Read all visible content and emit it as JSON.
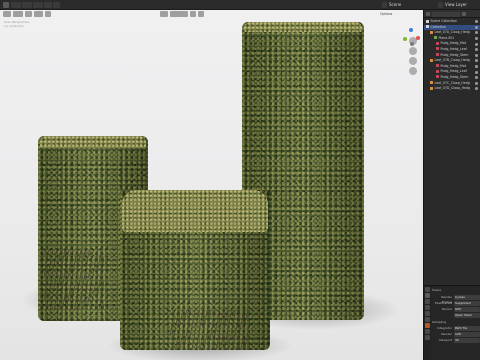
{
  "topbar": {
    "scene_label": "Scene",
    "view_layer_label": "View Layer"
  },
  "viewport": {
    "view_name": "User Perspective",
    "collection_label": "(1) Collection",
    "shading_label": "Options"
  },
  "outliner": {
    "title": "Scene Collection",
    "items": [
      {
        "label": "Scene Collection",
        "type": "collection",
        "selected": false
      },
      {
        "label": "Collection",
        "type": "collection",
        "selected": true
      },
      {
        "label": "Leaf_07A_Cloop_Hedg",
        "type": "object",
        "selected": false
      },
      {
        "label": "Plane.001",
        "type": "mesh",
        "selected": false
      },
      {
        "label": "Pudg_Hedg_Mat",
        "type": "material",
        "selected": false
      },
      {
        "label": "Pudg_Hedg_Leaf",
        "type": "material",
        "selected": false
      },
      {
        "label": "Pudg_Hedg_Stem",
        "type": "material",
        "selected": false
      },
      {
        "label": "Leaf_07B_Cloop_Hedg",
        "type": "object",
        "selected": false
      },
      {
        "label": "Pudg_Hedg_Mat",
        "type": "material",
        "selected": false
      },
      {
        "label": "Pudg_Hedg_Leaf",
        "type": "material",
        "selected": false
      },
      {
        "label": "Pudg_Hedg_Stem",
        "type": "material",
        "selected": false
      },
      {
        "label": "Leaf_07C_Cloop_Hedg",
        "type": "object",
        "selected": false
      },
      {
        "label": "Leaf_07D_Cloop_Hedg",
        "type": "object",
        "selected": false
      }
    ]
  },
  "properties": {
    "object_label": "Scene",
    "rows": [
      {
        "label": "Render Engine",
        "value": "Cycles"
      },
      {
        "label": "Feature Set",
        "value": "Supported"
      },
      {
        "label": "Device",
        "value": "GPU"
      },
      {
        "label": "",
        "value": "Open Shad"
      }
    ],
    "section": "Sampling",
    "rows2": [
      {
        "label": "Integrator",
        "value": "Path Tra"
      },
      {
        "label": "Render",
        "value": "128"
      },
      {
        "label": "Viewport",
        "value": "32"
      }
    ]
  },
  "colors": {
    "gizmo_x": "#e8504f",
    "gizmo_y": "#7ebb2c",
    "gizmo_z": "#3b7ddf",
    "selection": "#334d80"
  }
}
